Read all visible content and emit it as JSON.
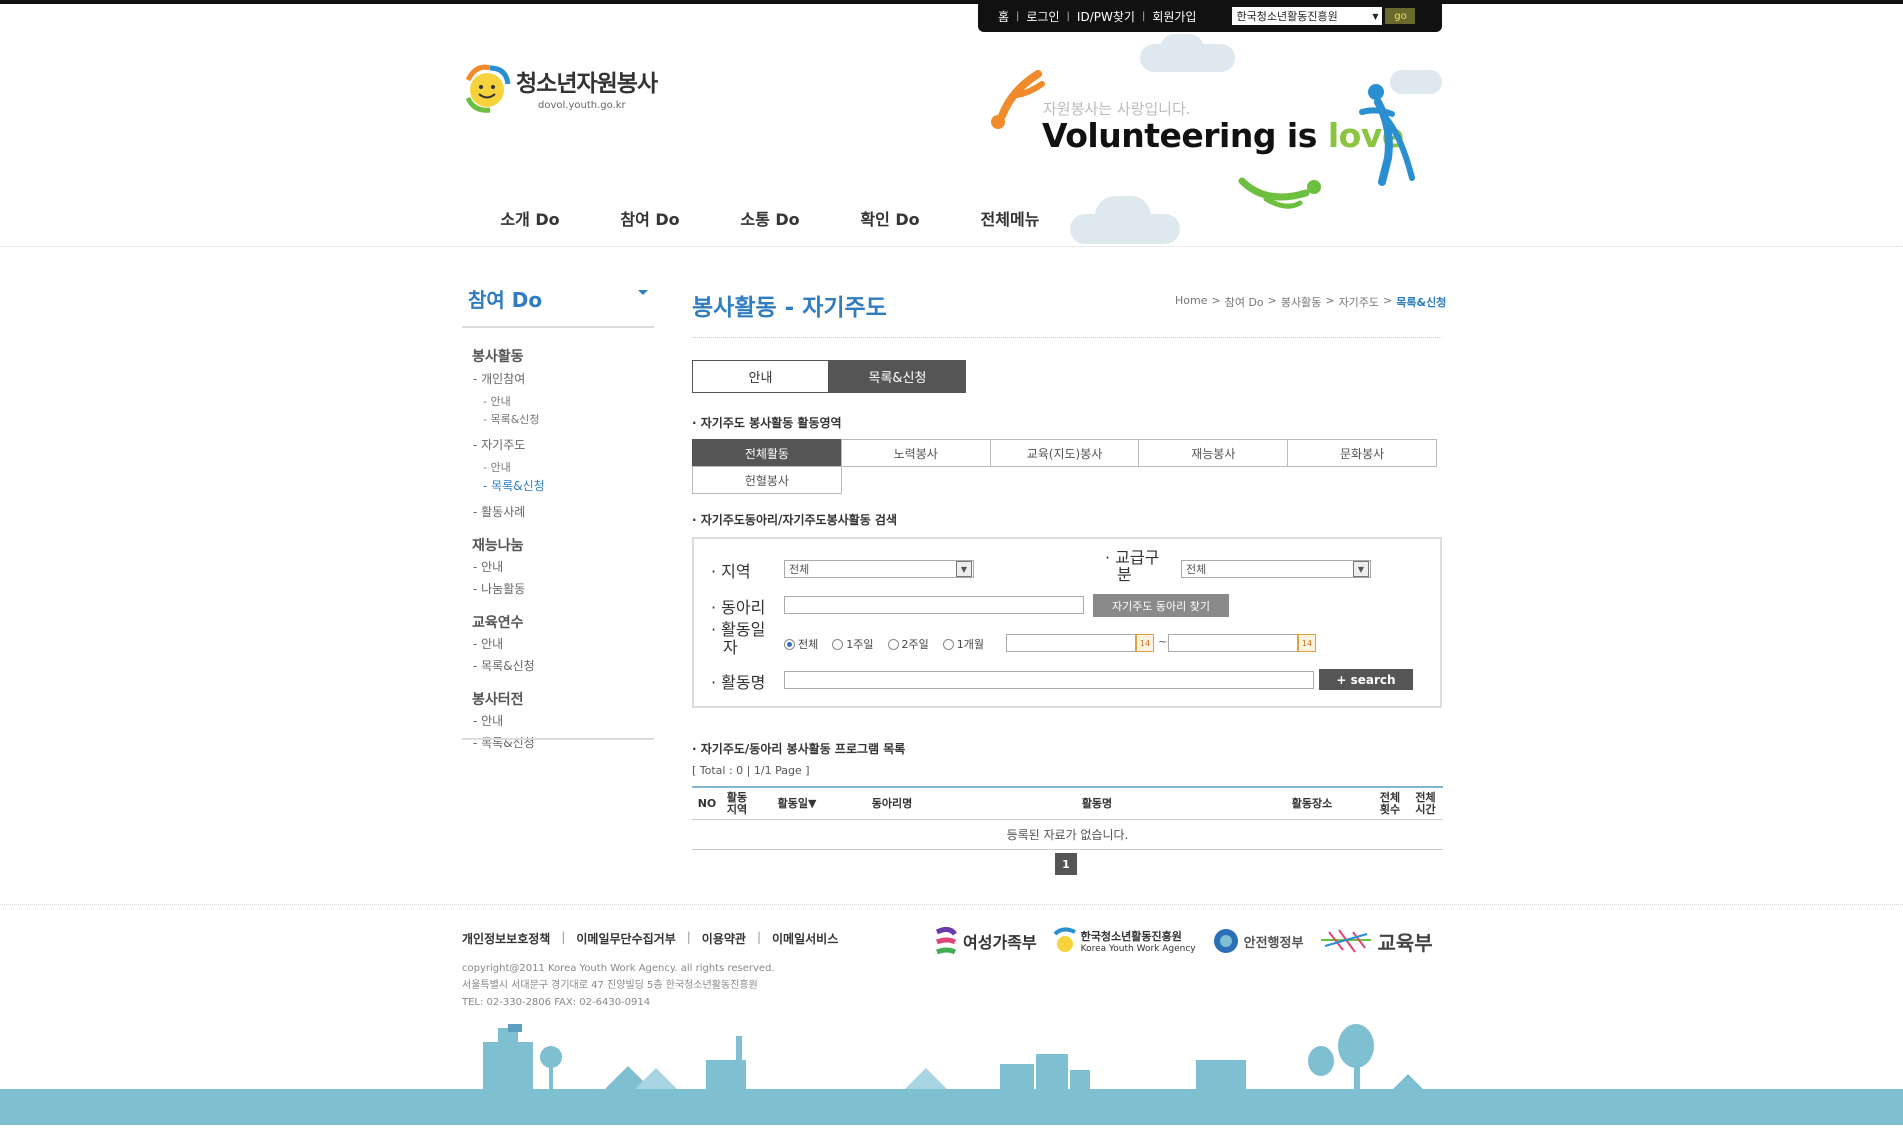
{
  "util": {
    "home": "홈",
    "login": "로그인",
    "idpw": "ID/PW찾기",
    "join": "회원가입",
    "site_select": "한국청소년활동진흥원",
    "go": "go"
  },
  "logo": {
    "title": "청소년자원봉사",
    "url": "dovol.youth.go.kr"
  },
  "banner": {
    "sub": "자원봉사는 사랑입니다.",
    "main_a": "Volunteering is ",
    "main_b": "love"
  },
  "gnb": [
    "소개 Do",
    "참여 Do",
    "소통 Do",
    "확인 Do",
    "전체메뉴"
  ],
  "lnb": {
    "title": "참여 Do",
    "g1": {
      "h": "봉사활동",
      "s1": "- 개인참여",
      "s1a": "- 안내",
      "s1b": "- 목록&신청",
      "s2": "- 자기주도",
      "s2a": "- 안내",
      "s2b": "- 목록&신청",
      "s3": "- 활동사례"
    },
    "g2": {
      "h": "재능나눔",
      "a": "- 안내",
      "b": "- 나눔활동"
    },
    "g3": {
      "h": "교육연수",
      "a": "- 안내",
      "b": "- 목록&신청"
    },
    "g4": {
      "h": "봉사터전",
      "a": "- 안내",
      "b": "- 목록&신청"
    }
  },
  "page": {
    "title": "봉사활동 - 자기주도",
    "breadcrumb": [
      "Home",
      ">",
      "참여 Do",
      ">",
      "봉사활동",
      ">",
      "자기주도",
      ">",
      "목록&신청"
    ]
  },
  "tabs": [
    "안내",
    "목록&신청"
  ],
  "sections": {
    "area": "자기주도 봉사활동 활동영역",
    "search": "자기주도동아리/자기주도봉사활동 검색",
    "list": "자기주도/동아리 봉사활동 프로그램 목록"
  },
  "areas": [
    "전체활동",
    "노력봉사",
    "교육(지도)봉사",
    "재능봉사",
    "문화봉사",
    "헌혈봉사"
  ],
  "search": {
    "region_label": "· 지역",
    "region_value": "전체",
    "school_label_1": "· 교급구",
    "school_label_2": "분",
    "school_value": "전체",
    "club_label": "· 동아리",
    "club_button": "자기주도 동아리 찾기",
    "date_label_1": "· 활동일",
    "date_label_2": "자",
    "periods": [
      "전체",
      "1주일",
      "2주일",
      "1개월"
    ],
    "tilde": "~",
    "name_label": "· 활동명",
    "search_button": "+ search"
  },
  "list": {
    "total": "[ Total : 0   |   1/1 Page ]",
    "headers": {
      "no": "NO",
      "region_1": "활동",
      "region_2": "지역",
      "date": "활동일▼",
      "club": "동아리명",
      "name": "활동명",
      "place": "활동장소",
      "count_1": "전체",
      "count_2": "횟수",
      "hours_1": "전체",
      "hours_2": "시간"
    },
    "empty": "등록된 자료가 없습니다.",
    "page": "1"
  },
  "footer": {
    "links": [
      "개인정보보호정책",
      "이메일무단수집거부",
      "이용약관",
      "이메일서비스"
    ],
    "copyright": "copyright@2011 Korea Youth Work Agency. all rights reserved.",
    "address": "서울특별시 서대문구 경기대로 47 진양빌딩 5층 한국청소년활동진흥원",
    "tel": "TEL: 02-330-2806   FAX: 02-6430-0914",
    "logos": {
      "mogef": "여성가족부",
      "kywa_1": "한국청소년활동진흥원",
      "kywa_2": "Korea Youth Work Agency",
      "mopas": "안전행정부",
      "moe": "교육부"
    }
  },
  "colors": {
    "accent": "#2f7cc0",
    "love": "#8bc43f",
    "ground": "#7ebfd2",
    "dark": "#555555"
  }
}
